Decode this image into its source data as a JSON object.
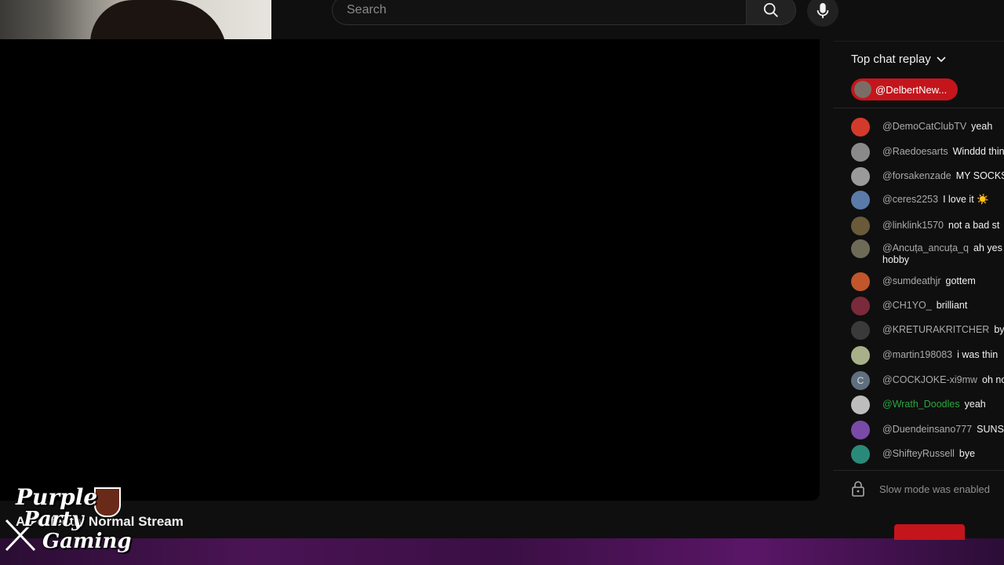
{
  "search": {
    "placeholder": "Search"
  },
  "chat": {
    "header": "Top chat replay",
    "pinned_author": "@DelbertNew...",
    "messages": [
      {
        "author": "@DemoCatClubTV",
        "body": "yeah",
        "avatar_color": "#d43a2a"
      },
      {
        "author": "@Raedoesarts",
        "body": "Winddd thin",
        "avatar_color": "#8a8a8a"
      },
      {
        "author": "@forsakenzade",
        "body": "MY SOCKS",
        "avatar_color": "#9a9a9a"
      },
      {
        "author": "@ceres2253",
        "body": "I love it ☀️",
        "avatar_color": "#5a7aa8"
      },
      {
        "author": "@linklink1570",
        "body": "not a bad st",
        "avatar_color": "#6a5a3a"
      },
      {
        "author": "@Ancuța_ancuța_q",
        "body": "ah yes hobby",
        "avatar_color": "#6e6a58"
      },
      {
        "author": "@sumdeathjr",
        "body": "gottem",
        "avatar_color": "#c0562a"
      },
      {
        "author": "@CH1YO_",
        "body": "brilliant",
        "avatar_color": "#7a2a3a"
      },
      {
        "author": "@KRETURAKRITCHER",
        "body": "bye",
        "avatar_color": "#3a3a3a"
      },
      {
        "author": "@martin198083",
        "body": "i was thin",
        "avatar_color": "#a8b08a"
      },
      {
        "author": "@COCKJOKE-xi9mw",
        "body": "oh no",
        "avatar_color": "#5f6f7f",
        "avatar_letter": "C"
      },
      {
        "author": "@Wrath_Doodles",
        "body": "yeah",
        "avatar_color": "#bdbdbd",
        "member": true
      },
      {
        "author": "@Duendeinsano777",
        "body": "SUNS",
        "avatar_color": "#7a4aa8"
      },
      {
        "author": "@ShifteyRussell",
        "body": "bye",
        "avatar_color": "#2a8a7a"
      }
    ],
    "slow_mode": "Slow mode was enabled"
  },
  "stream_title": "A Perfectly Normal Stream",
  "logo": {
    "line1": "Purple",
    "line2": "Party",
    "line3": "Gaming"
  },
  "colors": {
    "accent_red": "#c4151c",
    "member_green": "#2ba640",
    "bar_purple": "#4a1454"
  }
}
